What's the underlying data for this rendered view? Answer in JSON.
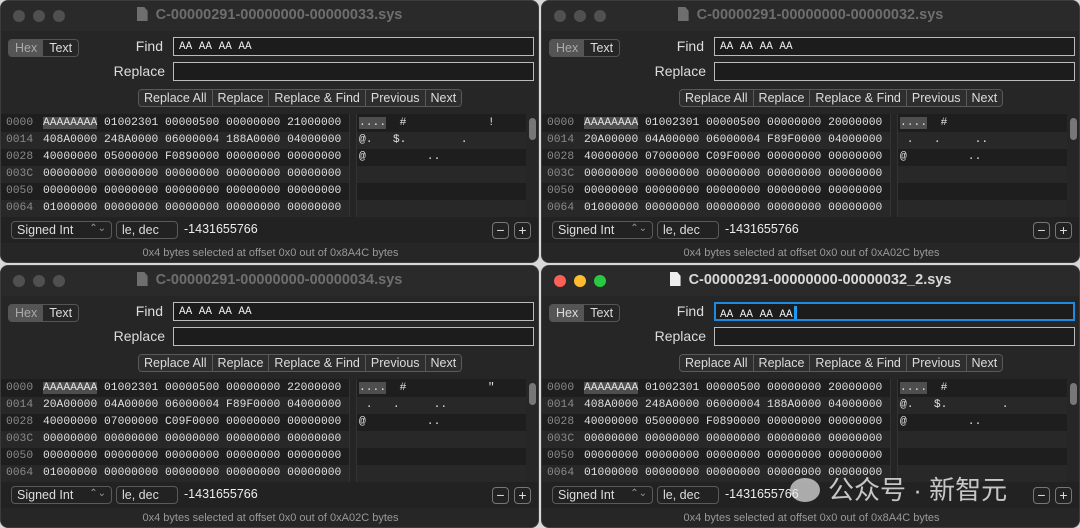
{
  "windows": [
    {
      "title": "C-00000291-00000000-00000033.sys",
      "active": false,
      "mode_tabs": [
        "Hex",
        "Text"
      ],
      "find_label": "Find",
      "find_value": "AA AA AA AA",
      "replace_label": "Replace",
      "replace_value": "",
      "buttons": [
        "Replace All",
        "Replace",
        "Replace & Find",
        "Previous",
        "Next"
      ],
      "rows": [
        {
          "offset": "0000",
          "hex": [
            "AAAAAAAA",
            "01002301",
            "00000500",
            "00000000",
            "21000000"
          ],
          "ascii_sel": "....",
          "ascii": "  #            !"
        },
        {
          "offset": "0014",
          "hex": [
            "408A0000",
            "248A0000",
            "06000004",
            "188A0000",
            "04000000"
          ],
          "ascii_sel": "",
          "ascii": "@.   $.        ."
        },
        {
          "offset": "0028",
          "hex": [
            "40000000",
            "05000000",
            "F0890000",
            "00000000",
            "00000000"
          ],
          "ascii_sel": "",
          "ascii": "@         .."
        },
        {
          "offset": "003C",
          "hex": [
            "00000000",
            "00000000",
            "00000000",
            "00000000",
            "00000000"
          ],
          "ascii_sel": "",
          "ascii": ""
        },
        {
          "offset": "0050",
          "hex": [
            "00000000",
            "00000000",
            "00000000",
            "00000000",
            "00000000"
          ],
          "ascii_sel": "",
          "ascii": ""
        },
        {
          "offset": "0064",
          "hex": [
            "01000000",
            "00000000",
            "00000000",
            "00000000",
            "00000000"
          ],
          "ascii_sel": "",
          "ascii": ""
        }
      ],
      "type_select": "Signed Int",
      "endian": "le, dec",
      "value": "-1431655766",
      "status": "0x4 bytes selected at offset 0x0 out of 0x8A4C bytes"
    },
    {
      "title": "C-00000291-00000000-00000032.sys",
      "active": false,
      "mode_tabs": [
        "Hex",
        "Text"
      ],
      "find_label": "Find",
      "find_value": "AA AA AA AA",
      "replace_label": "Replace",
      "replace_value": "",
      "buttons": [
        "Replace All",
        "Replace",
        "Replace & Find",
        "Previous",
        "Next"
      ],
      "rows": [
        {
          "offset": "0000",
          "hex": [
            "AAAAAAAA",
            "01002301",
            "00000500",
            "00000000",
            "20000000"
          ],
          "ascii_sel": "....",
          "ascii": "  #"
        },
        {
          "offset": "0014",
          "hex": [
            "20A00000",
            "04A00000",
            "06000004",
            "F89F0000",
            "04000000"
          ],
          "ascii_sel": "",
          "ascii": " .   .     .."
        },
        {
          "offset": "0028",
          "hex": [
            "40000000",
            "07000000",
            "C09F0000",
            "00000000",
            "00000000"
          ],
          "ascii_sel": "",
          "ascii": "@         .."
        },
        {
          "offset": "003C",
          "hex": [
            "00000000",
            "00000000",
            "00000000",
            "00000000",
            "00000000"
          ],
          "ascii_sel": "",
          "ascii": ""
        },
        {
          "offset": "0050",
          "hex": [
            "00000000",
            "00000000",
            "00000000",
            "00000000",
            "00000000"
          ],
          "ascii_sel": "",
          "ascii": ""
        },
        {
          "offset": "0064",
          "hex": [
            "01000000",
            "00000000",
            "00000000",
            "00000000",
            "00000000"
          ],
          "ascii_sel": "",
          "ascii": ""
        }
      ],
      "type_select": "Signed Int",
      "endian": "le, dec",
      "value": "-1431655766",
      "status": "0x4 bytes selected at offset 0x0 out of 0xA02C bytes"
    },
    {
      "title": "C-00000291-00000000-00000034.sys",
      "active": false,
      "mode_tabs": [
        "Hex",
        "Text"
      ],
      "find_label": "Find",
      "find_value": "AA AA AA AA",
      "replace_label": "Replace",
      "replace_value": "",
      "buttons": [
        "Replace All",
        "Replace",
        "Replace & Find",
        "Previous",
        "Next"
      ],
      "rows": [
        {
          "offset": "0000",
          "hex": [
            "AAAAAAAA",
            "01002301",
            "00000500",
            "00000000",
            "22000000"
          ],
          "ascii_sel": "....",
          "ascii": "  #            \""
        },
        {
          "offset": "0014",
          "hex": [
            "20A00000",
            "04A00000",
            "06000004",
            "F89F0000",
            "04000000"
          ],
          "ascii_sel": "",
          "ascii": " .   .     .."
        },
        {
          "offset": "0028",
          "hex": [
            "40000000",
            "07000000",
            "C09F0000",
            "00000000",
            "00000000"
          ],
          "ascii_sel": "",
          "ascii": "@         .."
        },
        {
          "offset": "003C",
          "hex": [
            "00000000",
            "00000000",
            "00000000",
            "00000000",
            "00000000"
          ],
          "ascii_sel": "",
          "ascii": ""
        },
        {
          "offset": "0050",
          "hex": [
            "00000000",
            "00000000",
            "00000000",
            "00000000",
            "00000000"
          ],
          "ascii_sel": "",
          "ascii": ""
        },
        {
          "offset": "0064",
          "hex": [
            "01000000",
            "00000000",
            "00000000",
            "00000000",
            "00000000"
          ],
          "ascii_sel": "",
          "ascii": ""
        }
      ],
      "type_select": "Signed Int",
      "endian": "le, dec",
      "value": "-1431655766",
      "status": "0x4 bytes selected at offset 0x0 out of 0xA02C bytes"
    },
    {
      "title": "C-00000291-00000000-00000032_2.sys",
      "active": true,
      "mode_tabs": [
        "Hex",
        "Text"
      ],
      "find_label": "Find",
      "find_value": "AA AA AA AA",
      "replace_label": "Replace",
      "replace_value": "",
      "buttons": [
        "Replace All",
        "Replace",
        "Replace & Find",
        "Previous",
        "Next"
      ],
      "rows": [
        {
          "offset": "0000",
          "hex": [
            "AAAAAAAA",
            "01002301",
            "00000500",
            "00000000",
            "20000000"
          ],
          "ascii_sel": "....",
          "ascii": "  #"
        },
        {
          "offset": "0014",
          "hex": [
            "408A0000",
            "248A0000",
            "06000004",
            "188A0000",
            "04000000"
          ],
          "ascii_sel": "",
          "ascii": "@.   $.        ."
        },
        {
          "offset": "0028",
          "hex": [
            "40000000",
            "05000000",
            "F0890000",
            "00000000",
            "00000000"
          ],
          "ascii_sel": "",
          "ascii": "@         .."
        },
        {
          "offset": "003C",
          "hex": [
            "00000000",
            "00000000",
            "00000000",
            "00000000",
            "00000000"
          ],
          "ascii_sel": "",
          "ascii": ""
        },
        {
          "offset": "0050",
          "hex": [
            "00000000",
            "00000000",
            "00000000",
            "00000000",
            "00000000"
          ],
          "ascii_sel": "",
          "ascii": ""
        },
        {
          "offset": "0064",
          "hex": [
            "01000000",
            "00000000",
            "00000000",
            "00000000",
            "00000000"
          ],
          "ascii_sel": "",
          "ascii": ""
        }
      ],
      "type_select": "Signed Int",
      "endian": "le, dec",
      "value": "-1431655766",
      "status": "0x4 bytes selected at offset 0x0 out of 0x8A4C bytes"
    }
  ],
  "controls": {
    "minus": "−",
    "plus": "+",
    "select_chevron": "⌃⌄"
  },
  "colors": {
    "close": "#fe5f57",
    "minimize": "#febc2e",
    "zoom": "#28c840",
    "inactive_light": "#505050",
    "focus": "#1e8ae0"
  },
  "watermark": "公众号 · 新智元"
}
